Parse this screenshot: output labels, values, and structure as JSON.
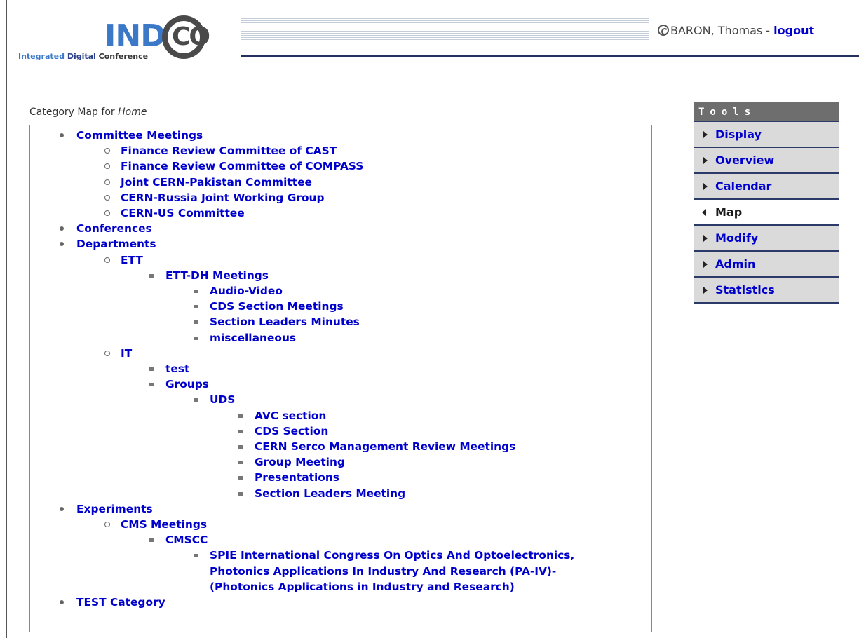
{
  "header": {
    "logo_indi": "INDI",
    "logo_co": "CO",
    "logo_sub_1": "Integrated",
    "logo_sub_2": "Digital",
    "logo_sub_3": "Conference",
    "user_name": "BARON, Thomas",
    "separator": " - ",
    "logout_label": "logout"
  },
  "map": {
    "title_prefix": "Category Map for ",
    "title_target": "Home",
    "items": [
      {
        "label": "Committee Meetings",
        "level": 0
      },
      {
        "label": "Finance Review Committee of CAST",
        "level": 1
      },
      {
        "label": "Finance Review Committee of COMPASS",
        "level": 1
      },
      {
        "label": "Joint CERN-Pakistan Committee",
        "level": 1
      },
      {
        "label": "CERN-Russia Joint Working Group",
        "level": 1
      },
      {
        "label": "CERN-US Committee",
        "level": 1
      },
      {
        "label": "Conferences",
        "level": 0
      },
      {
        "label": "Departments",
        "level": 0
      },
      {
        "label": "ETT",
        "level": 1
      },
      {
        "label": "ETT-DH Meetings",
        "level": 2
      },
      {
        "label": "Audio-Video",
        "level": 3
      },
      {
        "label": "CDS Section Meetings",
        "level": 3
      },
      {
        "label": "Section Leaders Minutes",
        "level": 3
      },
      {
        "label": "miscellaneous",
        "level": 3
      },
      {
        "label": "IT",
        "level": 1
      },
      {
        "label": "test",
        "level": 2
      },
      {
        "label": "Groups",
        "level": 2
      },
      {
        "label": "UDS",
        "level": 3
      },
      {
        "label": "AVC section",
        "level": 4
      },
      {
        "label": "CDS Section",
        "level": 4
      },
      {
        "label": "CERN Serco Management Review Meetings",
        "level": 4
      },
      {
        "label": "Group Meeting",
        "level": 4
      },
      {
        "label": "Presentations",
        "level": 4
      },
      {
        "label": "Section Leaders Meeting",
        "level": 4
      },
      {
        "label": "Experiments",
        "level": 0
      },
      {
        "label": "CMS Meetings",
        "level": 1
      },
      {
        "label": "CMSCC",
        "level": 2
      },
      {
        "label": "SPIE International Congress On Optics And Optoelectronics,",
        "level": 3
      },
      {
        "label": "Photonics Applications In Industry And Research (PA-IV)-",
        "level": 3,
        "continuation": true
      },
      {
        "label": "(Photonics Applications in Industry and Research)",
        "level": 3,
        "continuation": true
      },
      {
        "label": "TEST Category",
        "level": 0
      }
    ]
  },
  "tools": {
    "title": "Tools",
    "items": [
      {
        "label": "Display",
        "active": false
      },
      {
        "label": "Overview",
        "active": false
      },
      {
        "label": "Calendar",
        "active": false
      },
      {
        "label": "Map",
        "active": true
      },
      {
        "label": "Modify",
        "active": false
      },
      {
        "label": "Admin",
        "active": false
      },
      {
        "label": "Statistics",
        "active": false
      }
    ]
  }
}
